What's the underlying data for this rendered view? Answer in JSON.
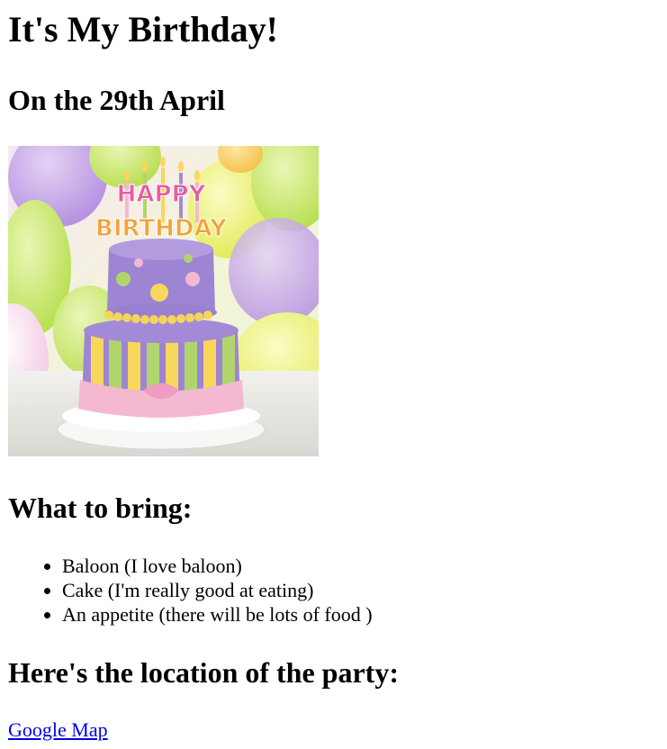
{
  "page": {
    "title": "It's My Birthday!",
    "date_heading": "On the 29th April"
  },
  "cake_image": {
    "topper_text_line1": "HAPPY",
    "topper_text_line2": "BIRTHDAY"
  },
  "bring": {
    "heading": "What to bring:",
    "items": [
      "Baloon (I love baloon)",
      "Cake (I'm really good at eating)",
      "An appetite (there will be lots of food )"
    ]
  },
  "location": {
    "heading": "Here's the location of the party:",
    "link_label": "Google Map"
  },
  "colors": {
    "link": "#0000ee",
    "cake_purple": "#9b7fd0",
    "cake_pink": "#f4b6d0",
    "cake_yellow": "#f3d552",
    "cake_green": "#a9cf6a"
  }
}
